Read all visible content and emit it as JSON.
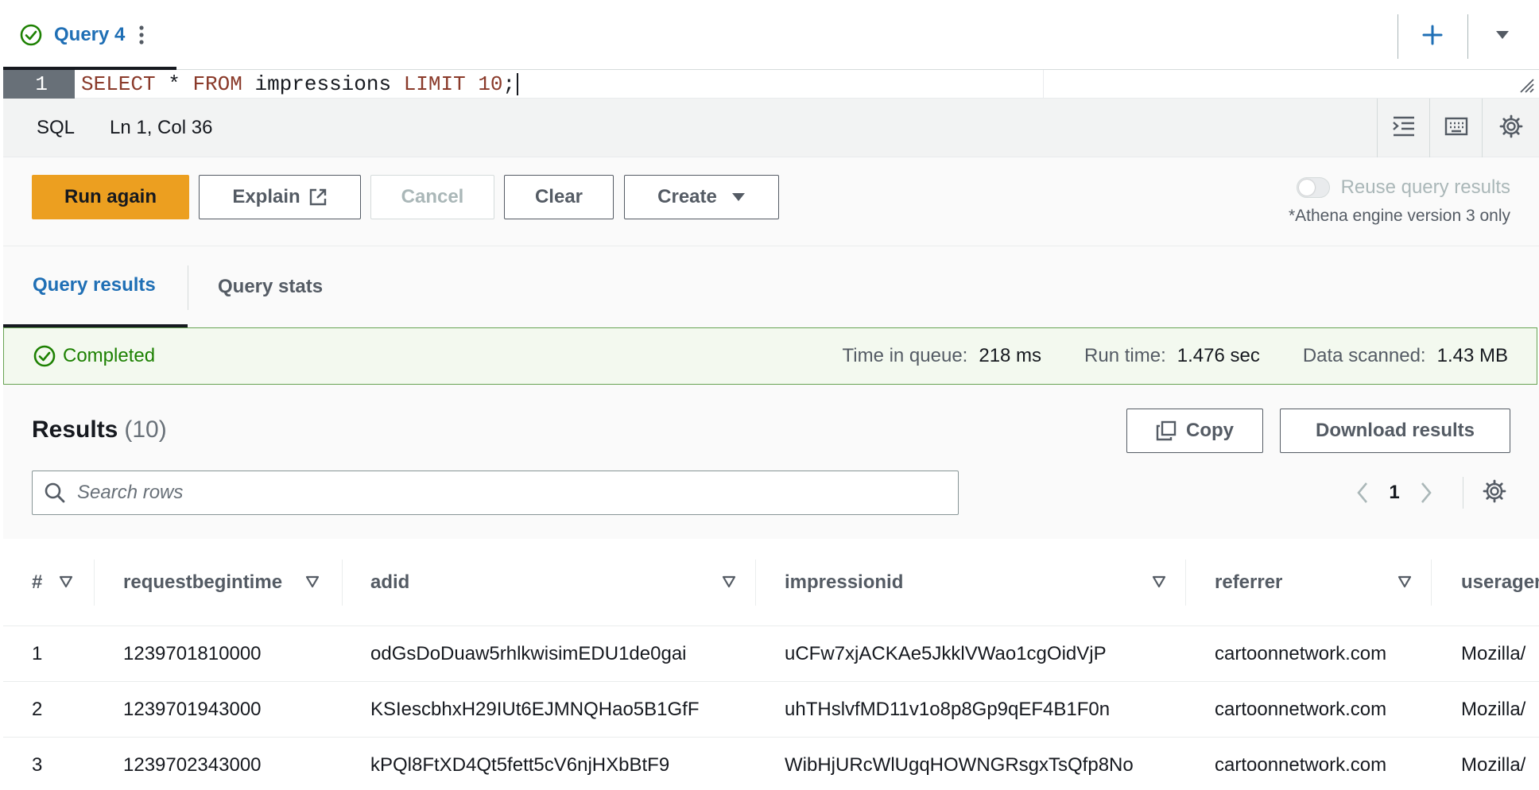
{
  "tabs": [
    {
      "label": "Query 4"
    }
  ],
  "editor": {
    "line_number": "1",
    "tokens": {
      "t1": "SELECT",
      "t2": " * ",
      "t3": "FROM",
      "t4": " impressions ",
      "t5": "LIMIT",
      "t6": " ",
      "t7": "10",
      "t8": ";"
    }
  },
  "status_bar": {
    "language": "SQL",
    "position": "Ln 1, Col 36"
  },
  "actions": {
    "run_again": "Run again",
    "explain": "Explain",
    "cancel": "Cancel",
    "clear": "Clear",
    "create": "Create",
    "reuse_label": "Reuse query results",
    "reuse_enabled": false,
    "engine_note": "*Athena engine version 3 only"
  },
  "result_tabs": {
    "results": "Query results",
    "stats": "Query stats"
  },
  "banner": {
    "status": "Completed",
    "time_in_queue_label": "Time in queue:",
    "time_in_queue_value": "218 ms",
    "run_time_label": "Run time:",
    "run_time_value": "1.476 sec",
    "data_scanned_label": "Data scanned:",
    "data_scanned_value": "1.43 MB"
  },
  "results": {
    "title": "Results",
    "count": "(10)",
    "copy": "Copy",
    "download": "Download results",
    "search_placeholder": "Search rows",
    "page": "1"
  },
  "table": {
    "columns": [
      "#",
      "requestbegintime",
      "adid",
      "impressionid",
      "referrer",
      "useragent"
    ],
    "rows": [
      [
        "1",
        "1239701810000",
        "odGsDoDuaw5rhlkwisimEDU1de0gai",
        "uCFw7xjACKAe5JkklVWao1cgOidVjP",
        "cartoonnetwork.com",
        "Mozilla/"
      ],
      [
        "2",
        "1239701943000",
        "KSIescbhxH29IUt6EJMNQHao5B1GfF",
        "uhTHslvfMD11v1o8p8Gp9qEF4B1F0n",
        "cartoonnetwork.com",
        "Mozilla/"
      ],
      [
        "3",
        "1239702343000",
        "kPQl8FtXD4Qt5fett5cV6njHXbBtF9",
        "WibHjURcWlUgqHOWNGRsgxTsQfp8No",
        "cartoonnetwork.com",
        "Mozilla/"
      ]
    ]
  },
  "colors": {
    "primary_button": "#ec9f20",
    "link_blue": "#1f6fb5",
    "success_green": "#1d8102",
    "banner_border": "#67a353",
    "banner_bg": "#f3f9ef"
  },
  "icons": {
    "tab_status": "check-circle-icon",
    "tab_menu": "more-vertical-icon",
    "add_tab": "plus-icon",
    "tab_dropdown": "caret-down-icon",
    "format": "indent-format-icon",
    "keyboard": "keyboard-icon",
    "settings": "gear-icon",
    "explain": "external-link-icon",
    "create": "caret-down-icon",
    "banner_status": "check-circle-icon",
    "copy": "copy-icon",
    "search": "search-icon",
    "prev": "chevron-left-icon",
    "next": "chevron-right-icon",
    "sort": "sort-caret-icon"
  }
}
